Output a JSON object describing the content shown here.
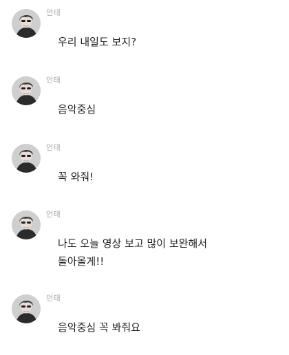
{
  "conversation": {
    "messages": [
      {
        "sender": "언태",
        "text": "우리 내일도 보지?"
      },
      {
        "sender": "언태",
        "text": "음악중심"
      },
      {
        "sender": "언태",
        "text": "꼭 와줘!"
      },
      {
        "sender": "언태",
        "text": "나도 오늘 영상 보고 많이 보완해서",
        "text_line2": "돌아올게!!"
      },
      {
        "sender": "언태",
        "text": "음악중심 꼭 봐줘요"
      }
    ]
  },
  "icons": {
    "avatar": "profile-photo-avatar"
  },
  "colors": {
    "background": "#ffffff",
    "sender_name": "#a8a8a8",
    "message_text": "#1f1f1f",
    "avatar_bg": "#d9d9d9"
  }
}
